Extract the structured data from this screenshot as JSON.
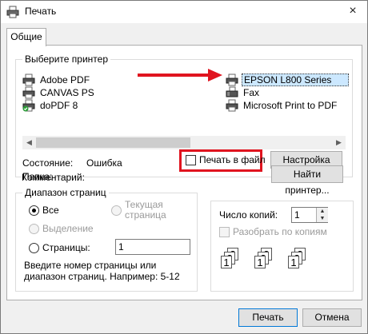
{
  "window": {
    "title": "Печать",
    "close_icon": "×"
  },
  "tabs": [
    {
      "label": "Общие"
    }
  ],
  "printers": {
    "group_title": "Выберите принтер",
    "items": [
      {
        "label": "Adobe PDF",
        "icon": "printer-icon"
      },
      {
        "label": "CANVAS PS",
        "icon": "printer-icon"
      },
      {
        "label": "doPDF 8",
        "icon": "printer-default-icon"
      },
      {
        "label": "EPSON L800 Series",
        "icon": "printer-icon",
        "selected": true
      },
      {
        "label": "Fax",
        "icon": "fax-icon"
      },
      {
        "label": "Microsoft Print to PDF",
        "icon": "printer-icon"
      }
    ],
    "scroll_left": "◀",
    "scroll_right": "▶"
  },
  "status": {
    "state_label": "Состояние:",
    "state_value": "Ошибка",
    "folder_label": "Папка:",
    "comment_label": "Комментарий:",
    "print_to_file_label": "Печать в файл",
    "print_to_file_checked": false,
    "settings_button": "Настройка",
    "find_printer_button": "Найти принтер..."
  },
  "range": {
    "group_title": "Диапазон страниц",
    "all": "Все",
    "current_page": "Текущая страница",
    "selection": "Выделение",
    "pages": "Страницы:",
    "pages_value": "1",
    "hint": "Введите номер страницы или диапазон страниц.  Например: 5-12",
    "selected": "all"
  },
  "copies": {
    "label": "Число копий:",
    "value": "1",
    "collate_label": "Разобрать по копиям",
    "collate_checked": false
  },
  "footer": {
    "print_button": "Печать",
    "cancel_button": "Отмена"
  },
  "colors": {
    "highlight": "#e0141f",
    "selection": "#cce8ff"
  }
}
